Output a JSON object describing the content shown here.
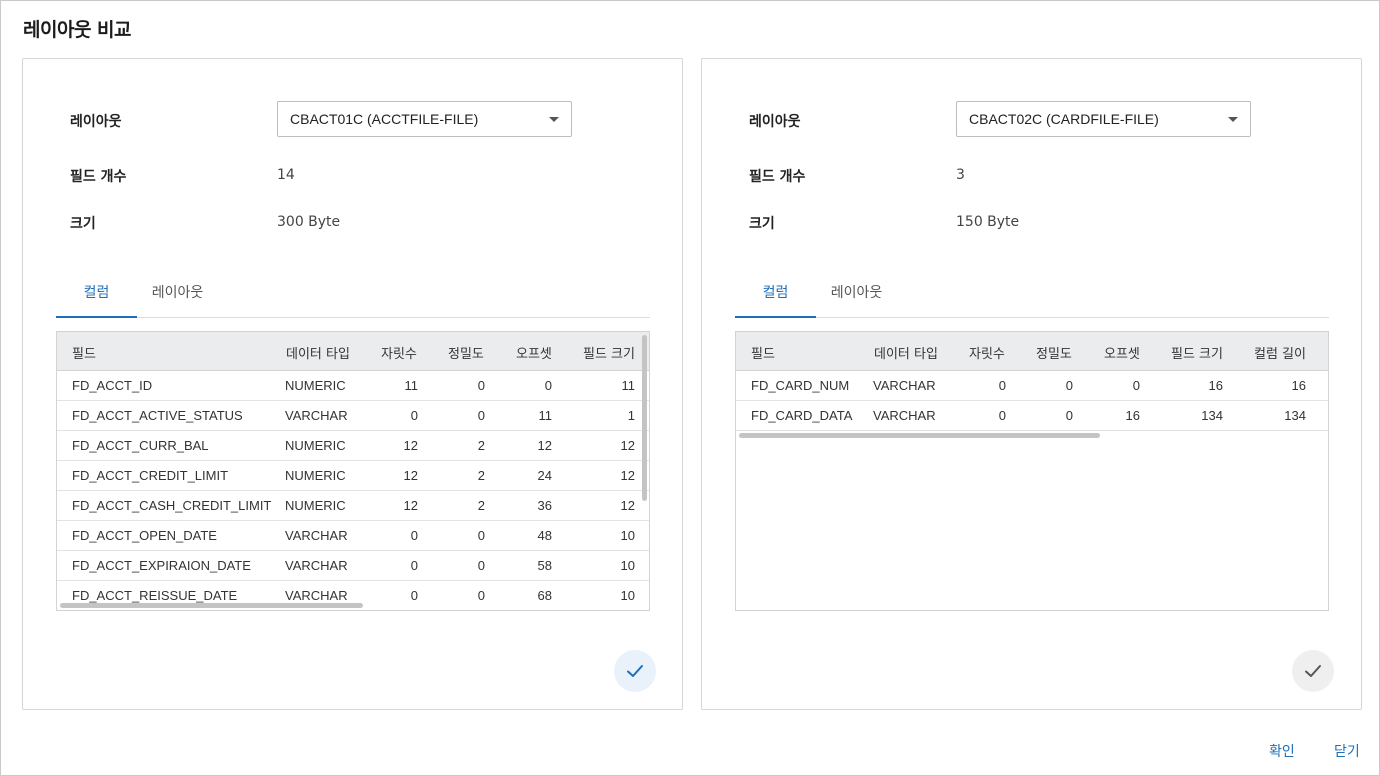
{
  "dialog": {
    "title": "레이아웃 비교",
    "confirm_label": "확인",
    "close_label": "닫기"
  },
  "labels": {
    "layout": "레이아웃",
    "field_count": "필드 개수",
    "size": "크기"
  },
  "colors": {
    "accent": "#1f6fb8",
    "grid_header_bg": "#ebecee"
  },
  "left": {
    "layout_value": "CBACT01C (ACCTFILE-FILE)",
    "field_count": "14",
    "size": "300 Byte",
    "tabs": [
      {
        "label": "컬럼",
        "active": true
      },
      {
        "label": "레이아웃",
        "active": false
      }
    ],
    "columns": [
      "필드",
      "데이터 타입",
      "자릿수",
      "정밀도",
      "오프셋",
      "필드 크기"
    ],
    "rows": [
      [
        "FD_ACCT_ID",
        "NUMERIC",
        "11",
        "0",
        "0",
        "11"
      ],
      [
        "FD_ACCT_ACTIVE_STATUS",
        "VARCHAR",
        "0",
        "0",
        "11",
        "1"
      ],
      [
        "FD_ACCT_CURR_BAL",
        "NUMERIC",
        "12",
        "2",
        "12",
        "12"
      ],
      [
        "FD_ACCT_CREDIT_LIMIT",
        "NUMERIC",
        "12",
        "2",
        "24",
        "12"
      ],
      [
        "FD_ACCT_CASH_CREDIT_LIMIT",
        "NUMERIC",
        "12",
        "2",
        "36",
        "12"
      ],
      [
        "FD_ACCT_OPEN_DATE",
        "VARCHAR",
        "0",
        "0",
        "48",
        "10"
      ],
      [
        "FD_ACCT_EXPIRAION_DATE",
        "VARCHAR",
        "0",
        "0",
        "58",
        "10"
      ],
      [
        "FD_ACCT_REISSUE_DATE",
        "VARCHAR",
        "0",
        "0",
        "68",
        "10"
      ]
    ],
    "check_icon": "check-icon"
  },
  "right": {
    "layout_value": "CBACT02C (CARDFILE-FILE)",
    "field_count": "3",
    "size": "150 Byte",
    "tabs": [
      {
        "label": "컬럼",
        "active": true
      },
      {
        "label": "레이아웃",
        "active": false
      }
    ],
    "columns": [
      "필드",
      "데이터 타입",
      "자릿수",
      "정밀도",
      "오프셋",
      "필드 크기",
      "컬럼 길이"
    ],
    "rows": [
      [
        "FD_CARD_NUM",
        "VARCHAR",
        "0",
        "0",
        "0",
        "16",
        "16"
      ],
      [
        "FD_CARD_DATA",
        "VARCHAR",
        "0",
        "0",
        "16",
        "134",
        "134"
      ]
    ],
    "check_icon": "check-icon"
  }
}
